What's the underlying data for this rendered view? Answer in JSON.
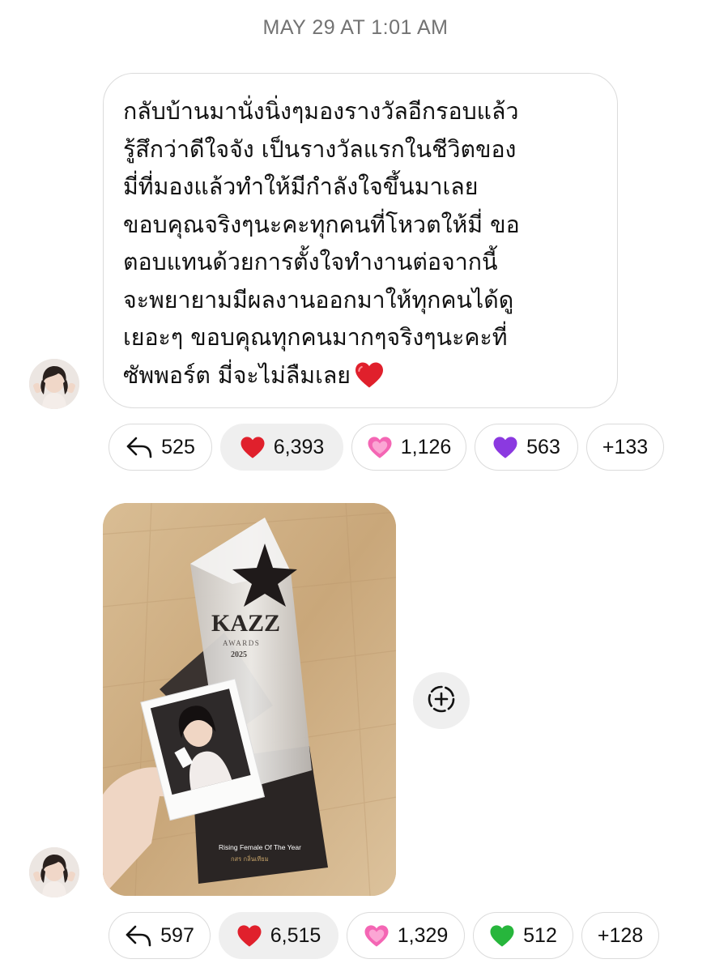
{
  "timestamp": "MAY 29 AT 1:01 AM",
  "message": {
    "lines": [
      "กลับบ้านมานั่งนิ่งๆมองรางวัลอีกรอบแล้ว",
      "รู้สึกว่าดีใจจัง เป็นรางวัลแรกในชีวิตของ",
      "มี่ที่มองแล้วทำให้มีกำลังใจขึ้นมาเลย",
      "ขอบคุณจริงๆนะคะทุกคนที่โหวตให้มี่ ขอ",
      "ตอบแทนด้วยการตั้งใจทำงานต่อจากนี้",
      "จะพยายามมีผลงานออกมาให้ทุกคนได้ดู",
      "เยอะๆ ขอบคุณทุกคนมากๆจริงๆนะคะที่",
      "ซัพพอร์ต มี่จะไม่ลืมเลย"
    ],
    "trailing_emoji": "red-heart",
    "reactions": {
      "replies": "525",
      "red_heart": "6,393",
      "pink_heart": "1,126",
      "purple_heart": "563",
      "more": "+133"
    }
  },
  "photo_message": {
    "photo_text": {
      "brand": "KAZZ",
      "awards": "AWARDS",
      "year": "2025",
      "plaque_title": "Rising Female Of The Year",
      "plaque_name": "กสร กลิ่นเทียม"
    },
    "reactions": {
      "replies": "597",
      "red_heart": "6,515",
      "pink_heart": "1,329",
      "green_heart": "512",
      "more": "+128"
    }
  },
  "colors": {
    "muted_text": "#737373",
    "border": "#dbdbdb",
    "active_pill": "#efefef",
    "red_heart": "#e0202c",
    "pink_heart": "#f466b4",
    "purple_heart": "#8b39e0",
    "green_heart": "#27b63c"
  }
}
